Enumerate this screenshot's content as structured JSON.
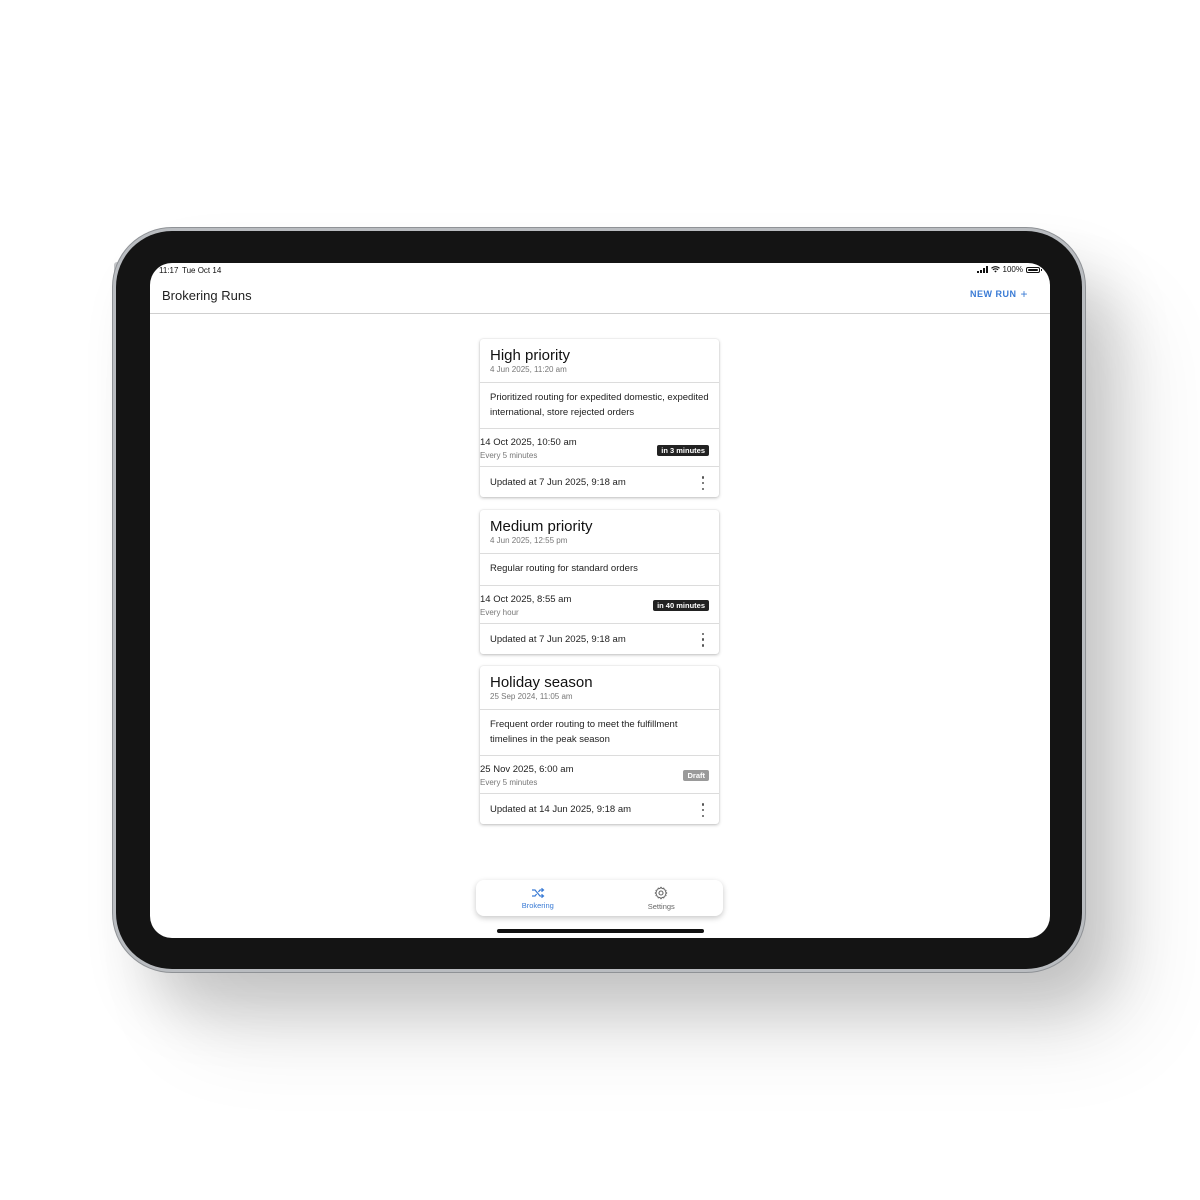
{
  "statusbar": {
    "time": "11:17",
    "date": "Tue Oct 14",
    "battery": "100%"
  },
  "header": {
    "title": "Brokering Runs",
    "new_run_label": "NEW RUN"
  },
  "runs": [
    {
      "title": "High priority",
      "created": "4 Jun 2025, 11:20 am",
      "description": "Prioritized routing for expedited domestic, expedited international, store rejected orders",
      "next_run": "14 Oct 2025, 10:50 am",
      "frequency": "Every 5 minutes",
      "badge": "in 3 minutes",
      "updated": "Updated at 7 Jun 2025, 9:18 am"
    },
    {
      "title": "Medium priority",
      "created": "4 Jun 2025, 12:55 pm",
      "description": "Regular routing for standard orders",
      "next_run": "14 Oct 2025, 8:55 am",
      "frequency": "Every hour",
      "badge": "in 40  minutes",
      "updated": "Updated at 7 Jun 2025, 9:18 am"
    },
    {
      "title": "Holiday season",
      "created": "25 Sep 2024, 11:05 am",
      "description": "Frequent order routing to meet the fulfillment timelines in the peak season",
      "next_run": "25 Nov 2025, 6:00 am",
      "frequency": "Every 5 minutes",
      "badge": "Draft",
      "updated": "Updated at 14 Jun 2025, 9:18 am"
    }
  ],
  "tabs": [
    {
      "label": "Brokering",
      "icon": "shuffle-icon",
      "active": true
    },
    {
      "label": "Settings",
      "icon": "gear-icon",
      "active": false
    }
  ],
  "colors": {
    "accent": "#3a7bd5",
    "badge_dark": "#222222",
    "badge_draft": "#9a9a9a"
  }
}
